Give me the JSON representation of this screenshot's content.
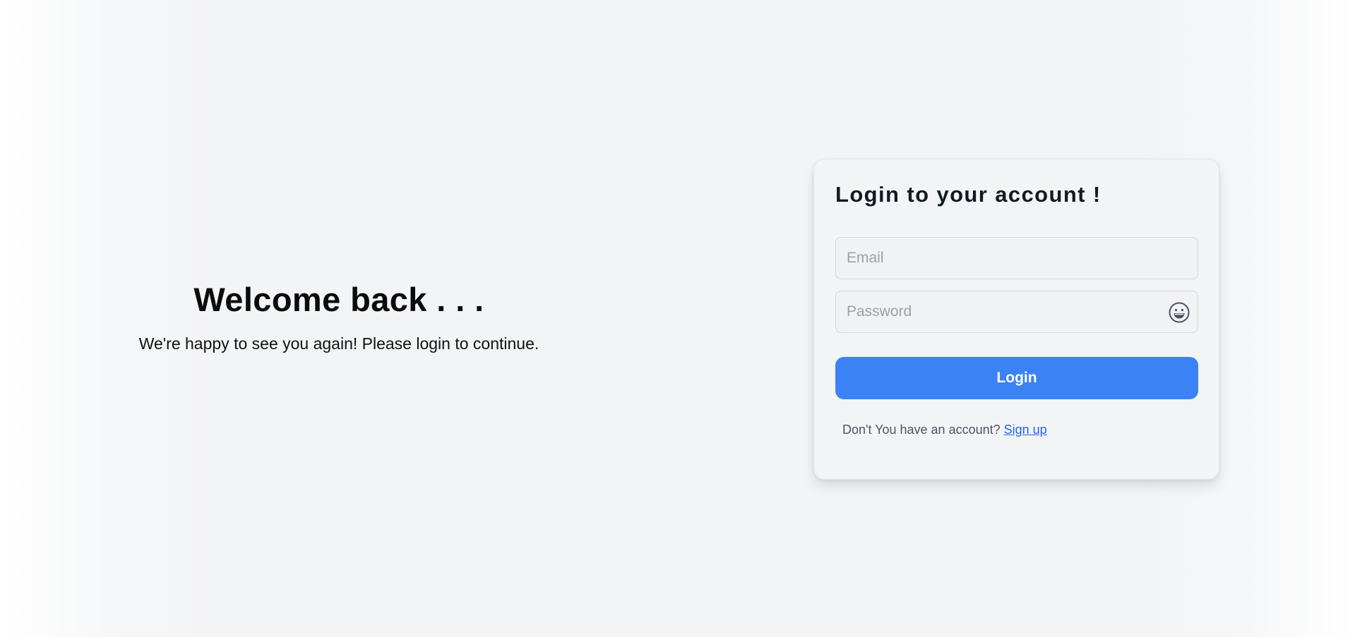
{
  "welcome": {
    "heading": "Welcome back . . .",
    "subtext": "We're happy to see you again! Please login to continue."
  },
  "login_card": {
    "title": "Login to your account !",
    "email": {
      "placeholder": "Email",
      "value": ""
    },
    "password": {
      "placeholder": "Password",
      "value": "",
      "toggle_icon": "grinning-face-icon"
    },
    "submit_label": "Login",
    "signup_prompt": "Don't You have an account?",
    "signup_link": "Sign up"
  },
  "colors": {
    "accent": "#3b82f6",
    "link": "#2563eb",
    "background": "#f3f4f6"
  }
}
